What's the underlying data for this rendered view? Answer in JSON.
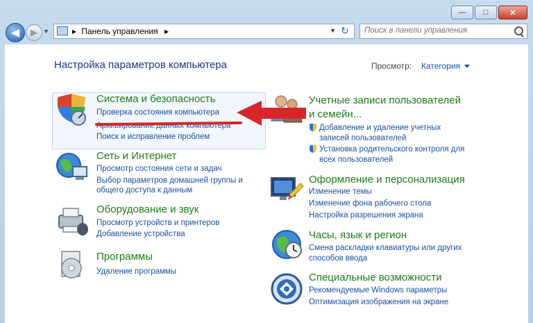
{
  "window": {
    "minimize_glyph": "—",
    "maximize_glyph": "□",
    "close_glyph": "✕"
  },
  "navigation": {
    "back_glyph": "◀",
    "forward_glyph": "▶",
    "address_separator": "▸",
    "address_path": "Панель управления",
    "address_trailing_separator": "▸",
    "refresh_glyph": "↻"
  },
  "search": {
    "placeholder": "Поиск в панели управления"
  },
  "header": {
    "title": "Настройка параметров компьютера",
    "view_by_label": "Просмотр:",
    "view_by_value": "Категория"
  },
  "categories": [
    {
      "title": "Система и безопасность",
      "links": [
        "Проверка состояния компьютера",
        "Архивирование данных компьютера",
        "Поиск и исправление проблем"
      ]
    },
    {
      "title": "Сеть и Интернет",
      "links": [
        "Просмотр состояния сети и задач",
        "Выбор параметров домашней группы и",
        "общего доступа к данным"
      ]
    },
    {
      "title": "Оборудование и звук",
      "links": [
        "Просмотр устройств и принтеров",
        "Добавление устройства"
      ]
    },
    {
      "title": "Программы",
      "links": [
        "Удаление программы"
      ]
    },
    {
      "title_line1": "Учетные записи пользователей",
      "title_line2": "и семейн...",
      "links": [
        "Добавление и удаление учетных",
        "записей пользователей",
        "Установка родительского контроля для",
        "всех пользователей"
      ]
    },
    {
      "title": "Оформление и персонализация",
      "links": [
        "Изменение темы",
        "Изменение фона рабочего стола",
        "Настройка разрешения экрана"
      ]
    },
    {
      "title": "Часы, язык и регион",
      "links": [
        "Смена раскладки клавиатуры или других",
        "способов ввода"
      ]
    },
    {
      "title": "Специальные возможности",
      "links": [
        "Рекомендуемые Windows параметры",
        "Оптимизация изображения на экране"
      ]
    }
  ],
  "colors": {
    "category_title": "#1e7a18",
    "link": "#1a4fa3",
    "heading": "#1e3287",
    "annotation_arrow": "#d7262a"
  }
}
